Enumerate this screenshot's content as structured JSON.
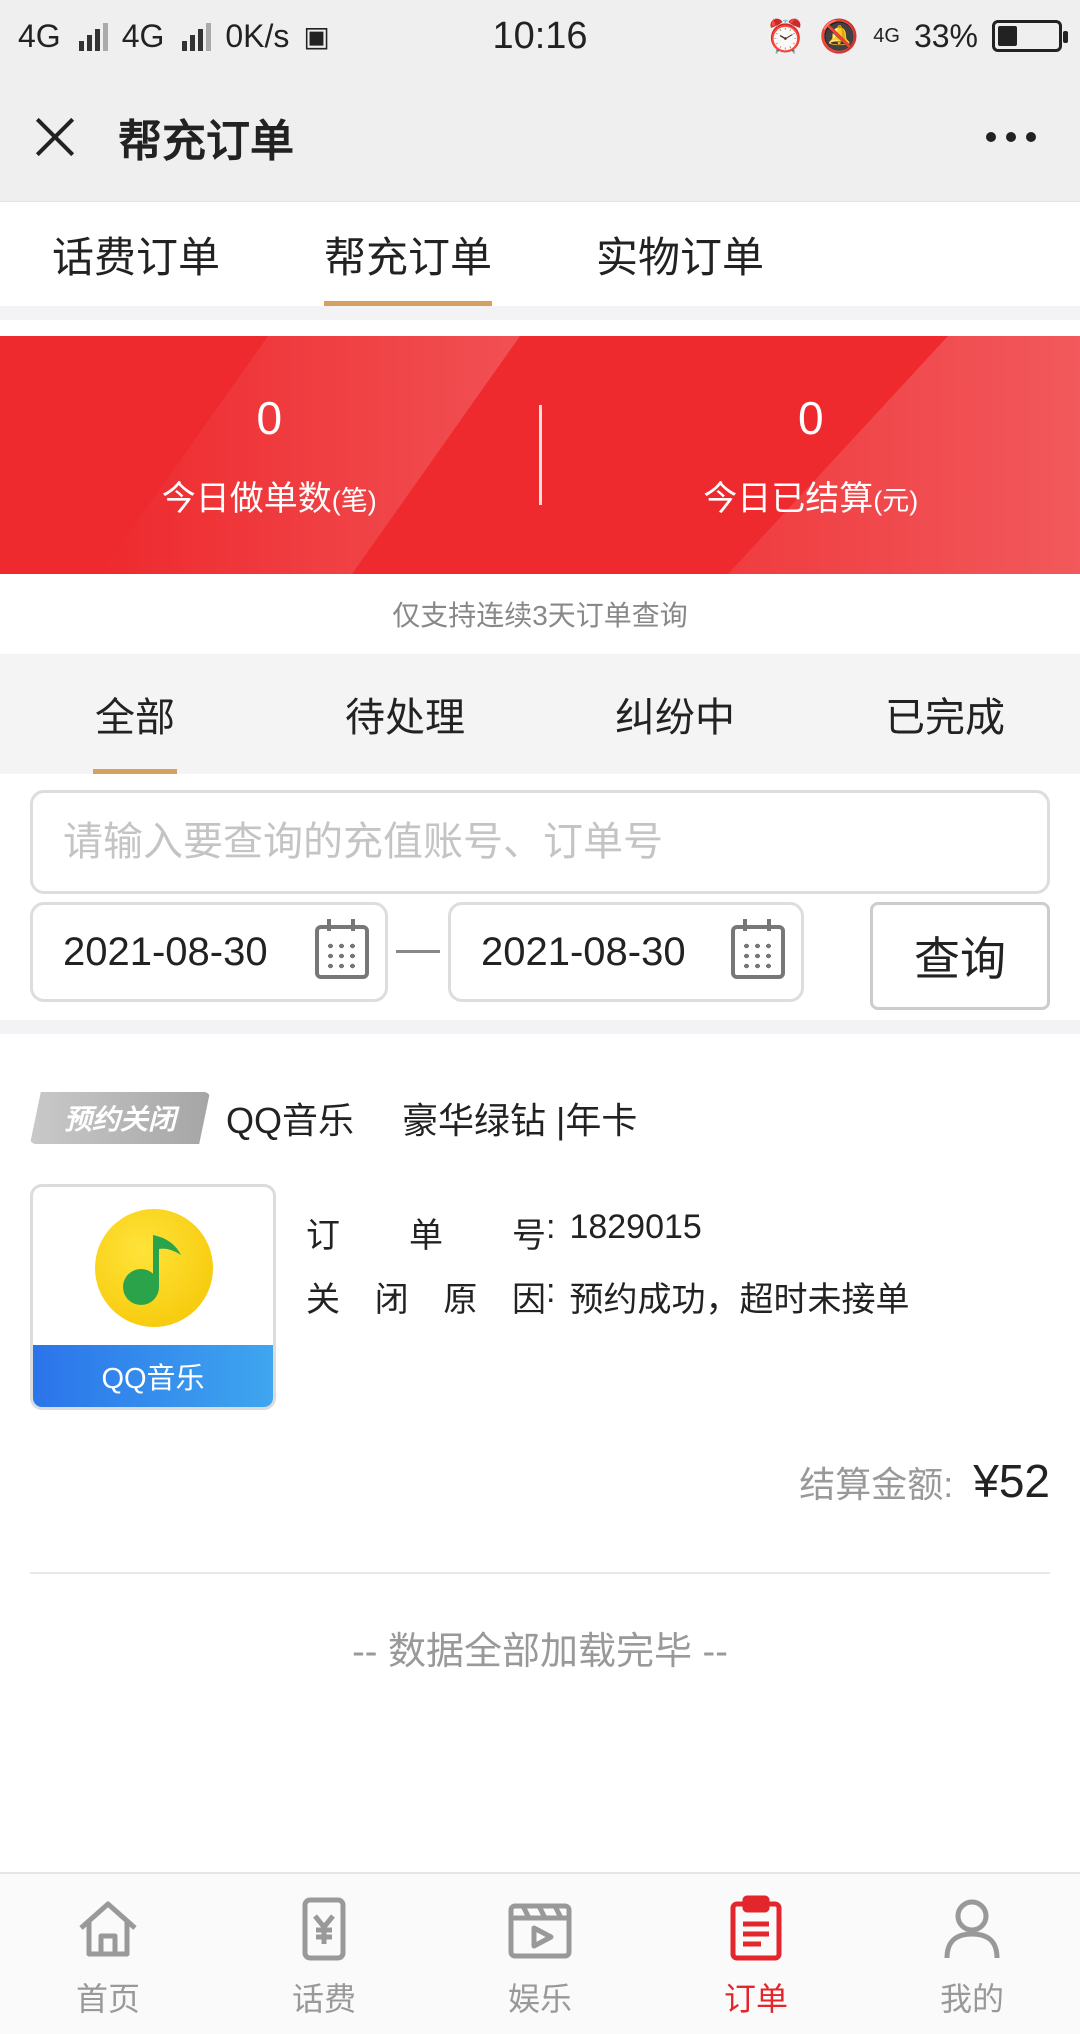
{
  "status_bar": {
    "net1": "4G",
    "net2": "4G",
    "speed": "0K/s",
    "time": "10:16",
    "net3": "4G",
    "battery": "33%",
    "battery_level": 0.33
  },
  "header": {
    "title": "帮充订单"
  },
  "top_tabs": [
    {
      "label": "话费订单",
      "active": false
    },
    {
      "label": "帮充订单",
      "active": true
    },
    {
      "label": "实物订单",
      "active": false
    }
  ],
  "banner": {
    "today_orders": {
      "value": "0",
      "label": "今日做单数",
      "unit": "(笔)"
    },
    "today_settled": {
      "value": "0",
      "label": "今日已结算",
      "unit": "(元)"
    }
  },
  "notice": "仅支持连续3天订单查询",
  "filter_tabs": [
    {
      "label": "全部",
      "active": true
    },
    {
      "label": "待处理",
      "active": false
    },
    {
      "label": "纠纷中",
      "active": false
    },
    {
      "label": "已完成",
      "active": false
    }
  ],
  "search": {
    "placeholder": "请输入要查询的充值账号、订单号",
    "start_date": "2021-08-30",
    "end_date": "2021-08-30",
    "button": "查询"
  },
  "order": {
    "status": "预约关闭",
    "product": "QQ音乐",
    "spec": "豪华绿钻 |年卡",
    "logo_label": "QQ音乐",
    "order_no_label": [
      "订",
      "单",
      "号"
    ],
    "order_no_colon": ":",
    "order_no": "1829015",
    "reason_label": [
      "关",
      "闭",
      "原",
      "因"
    ],
    "reason_colon": ":",
    "reason": "预约成功，超时未接单",
    "settle_label": "结算金额:",
    "settle_amount": "¥52"
  },
  "load_done": "-- 数据全部加载完毕 --",
  "bottom_nav": [
    {
      "label": "首页",
      "icon": "home-icon",
      "active": false
    },
    {
      "label": "话费",
      "icon": "phone-bill-icon",
      "active": false
    },
    {
      "label": "娱乐",
      "icon": "play-video-icon",
      "active": false
    },
    {
      "label": "订单",
      "icon": "clipboard-icon",
      "active": true
    },
    {
      "label": "我的",
      "icon": "user-icon",
      "active": false
    }
  ],
  "colors": {
    "accent_red": "#e3262b",
    "banner_red": "#ee2a2e",
    "tab_underline": "#d5a060"
  }
}
